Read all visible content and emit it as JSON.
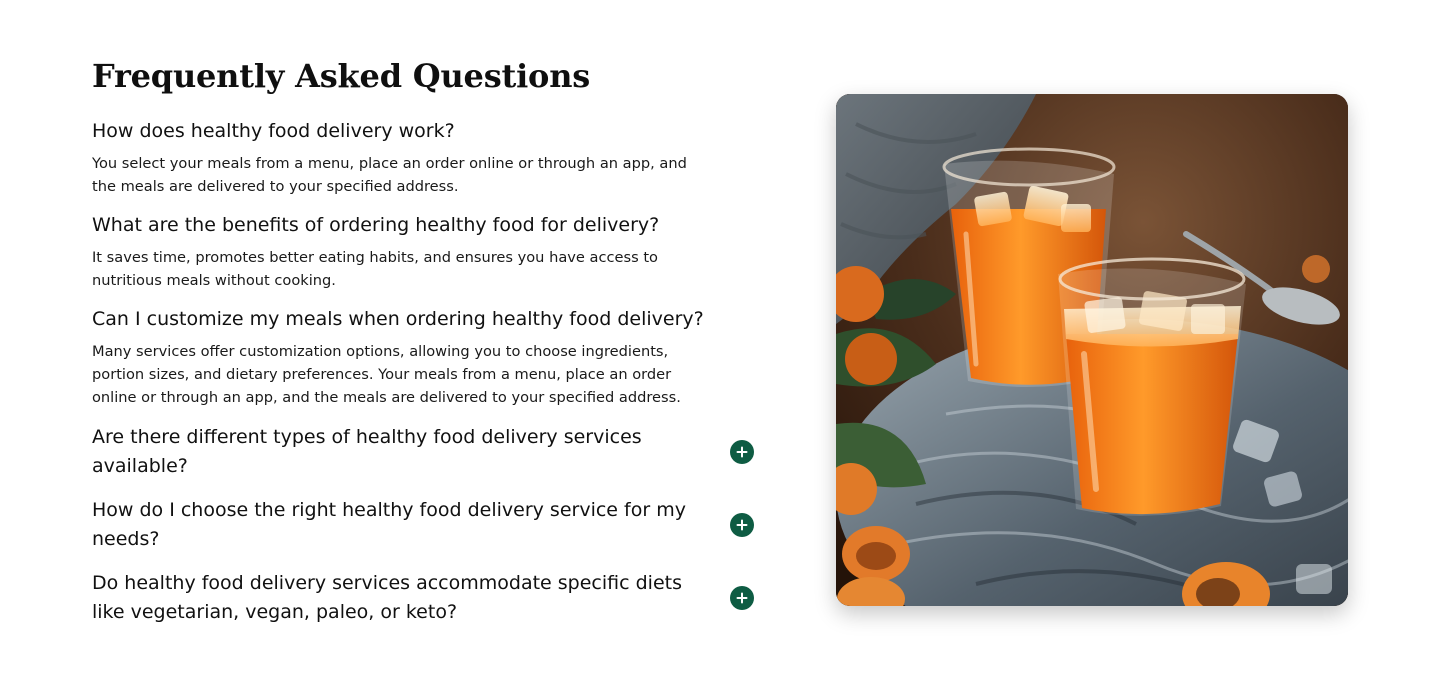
{
  "faq": {
    "title": "Frequently Asked Questions",
    "open_items": [
      {
        "question": "How does healthy food delivery work?",
        "answer": "You select your meals from a menu, place an order online or through an app, and the meals are delivered to your specified address."
      },
      {
        "question": "What are the benefits of ordering healthy food for delivery?",
        "answer": "It saves time, promotes better eating habits, and ensures you have access to nutritious meals without cooking."
      },
      {
        "question": "Can I customize my meals when ordering healthy food delivery?",
        "answer": "Many services offer customization options, allowing you to choose ingredients, portion sizes, and dietary preferences. Your meals from a menu, place an order online or through an app, and the meals are delivered to your specified address."
      }
    ],
    "collapsed_items": [
      {
        "question": "Are there different types of healthy food delivery services available?",
        "icon": "plus-icon"
      },
      {
        "question": "How do I choose the right healthy food delivery service for my needs?",
        "icon": "plus-icon"
      },
      {
        "question": "Do healthy food delivery services accommodate specific diets like vegetarian, vegan, paleo, or keto?",
        "icon": "plus-icon"
      }
    ],
    "accent_color": "#0e5c43"
  },
  "image": {
    "subject": "two-glasses-of-apricot-iced-drink"
  }
}
